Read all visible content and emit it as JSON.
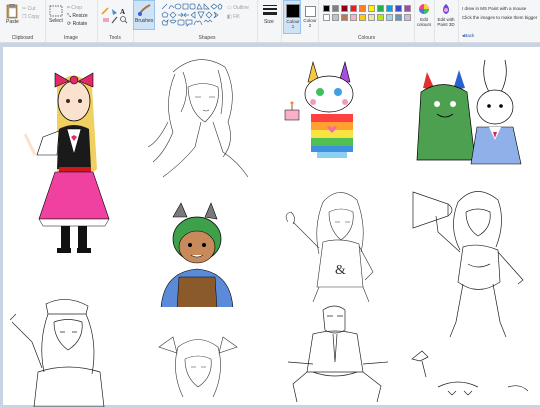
{
  "ribbon": {
    "clipboard": {
      "paste": "Paste",
      "cut": "Cut",
      "copy": "Copy",
      "label": "Clipboard"
    },
    "image": {
      "select": "Select",
      "crop": "Crop",
      "resize": "Resize",
      "rotate": "Rotate",
      "label": "Image"
    },
    "tools": {
      "label": "Tools"
    },
    "brushes": {
      "label": "Brushes"
    },
    "shapes": {
      "outline": "Outline",
      "fill": "Fill",
      "label": "Shapes"
    },
    "size": {
      "label": "Size"
    },
    "colour1": {
      "label": "Colour 1"
    },
    "colour2": {
      "label": "Colour 2"
    },
    "colours": {
      "label": "Colours",
      "edit": "Edit colours"
    },
    "paint3d": {
      "label": "Edit with Paint 3D"
    },
    "notes": {
      "line1": "I drew in MS Paint with a mouse",
      "line2": "Click the images to make them bigger",
      "back": "◂Back"
    }
  },
  "palette": [
    "#000000",
    "#7f7f7f",
    "#880015",
    "#ed1c24",
    "#ff7f27",
    "#fff200",
    "#22b14c",
    "#00a2e8",
    "#3f48cc",
    "#a349a4",
    "#ffffff",
    "#c3c3c3",
    "#b97a57",
    "#ffaec9",
    "#ffc90e",
    "#efe4b0",
    "#b5e61d",
    "#99d9ea",
    "#7092be",
    "#c8bfe7"
  ],
  "colors": {
    "colour1": "#000000",
    "colour2": "#ffffff",
    "accent": "#cfe3f7"
  }
}
